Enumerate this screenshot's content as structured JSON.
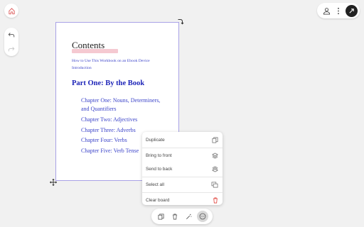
{
  "document": {
    "title": "Contents",
    "intro_lines": [
      "How to Use This Workbook on an Ebook Device",
      "Introduction"
    ],
    "part_heading": "Part One: By the Book",
    "chapters": [
      "Chapter One: Nouns, Determiners,",
      "and Quantifiers",
      "Chapter Two: Adjectives",
      "Chapter Three: Adverbs",
      "Chapter Four: Verbs",
      "Chapter Five: Verb Tense"
    ]
  },
  "context_menu": {
    "items": [
      {
        "label": "Duplicate",
        "icon": "duplicate-icon"
      },
      {
        "label": "Bring to front",
        "icon": "bring-to-front-icon"
      },
      {
        "label": "Send to back",
        "icon": "send-to-back-icon"
      },
      {
        "label": "Select all",
        "icon": "select-all-icon"
      },
      {
        "label": "Clear board",
        "icon": "trash-icon"
      }
    ]
  },
  "toolbar_icons": [
    "copy-icon",
    "trash-icon",
    "magic-wand-icon",
    "more-icon"
  ],
  "top_icons": [
    "user-icon",
    "kebab-menu-icon",
    "share-icon"
  ],
  "left_icons": [
    "home-icon",
    "undo-icon",
    "redo-icon"
  ],
  "colors": {
    "selection_border": "#a9a2e6",
    "link_text": "#3b43c9",
    "heading_text": "#1d24b8",
    "highlight": "#f5c9d1",
    "danger": "#e0403a",
    "home_accent": "#e06a6a"
  }
}
